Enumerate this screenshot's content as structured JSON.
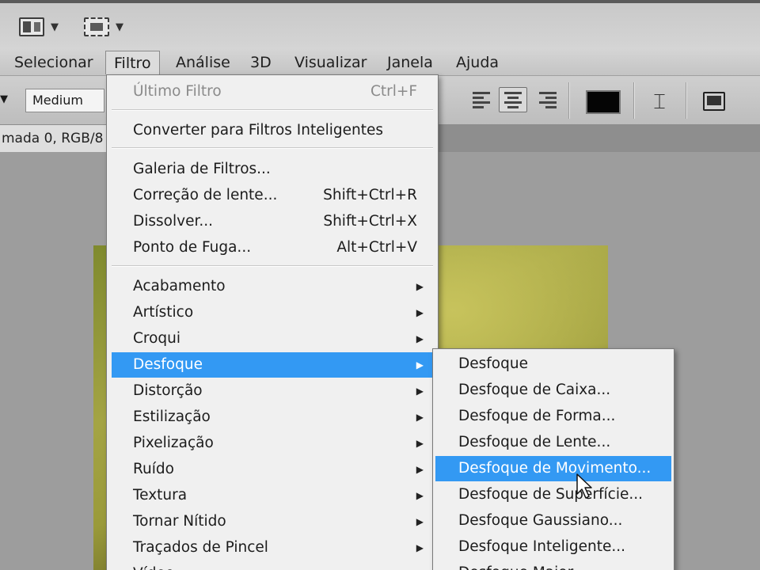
{
  "toolbar": {
    "icons": [
      "layout-icon",
      "screen-mode-icon"
    ]
  },
  "menubar": {
    "items": [
      {
        "label": "Selecionar"
      },
      {
        "label": "Filtro"
      },
      {
        "label": "Análise"
      },
      {
        "label": "3D"
      },
      {
        "label": "Visualizar"
      },
      {
        "label": "Janela"
      },
      {
        "label": "Ajuda"
      }
    ],
    "active": "Filtro"
  },
  "options": {
    "font_style": "Medium",
    "color": "#050505"
  },
  "document": {
    "tab_label": "mada 0, RGB/8"
  },
  "filter_menu": {
    "last_filter": {
      "label": "Último Filtro",
      "shortcut": "Ctrl+F"
    },
    "convert": {
      "label": "Converter para Filtros Inteligentes"
    },
    "gallery": {
      "label": "Galeria de Filtros..."
    },
    "lens": {
      "label": "Correção de lente...",
      "shortcut": "Shift+Ctrl+R"
    },
    "liquify": {
      "label": "Dissolver...",
      "shortcut": "Shift+Ctrl+X"
    },
    "vanishing": {
      "label": "Ponto de Fuga...",
      "shortcut": "Alt+Ctrl+V"
    },
    "groups": [
      {
        "label": "Acabamento"
      },
      {
        "label": "Artístico"
      },
      {
        "label": "Croqui"
      },
      {
        "label": "Desfoque"
      },
      {
        "label": "Distorção"
      },
      {
        "label": "Estilização"
      },
      {
        "label": "Pixelização"
      },
      {
        "label": "Ruído"
      },
      {
        "label": "Textura"
      },
      {
        "label": "Tornar Nítido"
      },
      {
        "label": "Traçados de Pincel"
      },
      {
        "label": "Vídeo"
      }
    ],
    "highlighted": "Desfoque"
  },
  "blur_submenu": {
    "items": [
      {
        "label": "Desfoque"
      },
      {
        "label": "Desfoque de Caixa..."
      },
      {
        "label": "Desfoque de Forma..."
      },
      {
        "label": "Desfoque de Lente..."
      },
      {
        "label": "Desfoque de Movimento..."
      },
      {
        "label": "Desfoque de Superfície..."
      },
      {
        "label": "Desfoque Gaussiano..."
      },
      {
        "label": "Desfoque Inteligente..."
      },
      {
        "label": "Desfoque Maior"
      }
    ],
    "highlighted": "Desfoque de Movimento..."
  },
  "colors": {
    "highlight": "#3399f3",
    "menu_bg": "#f0f0f0"
  }
}
